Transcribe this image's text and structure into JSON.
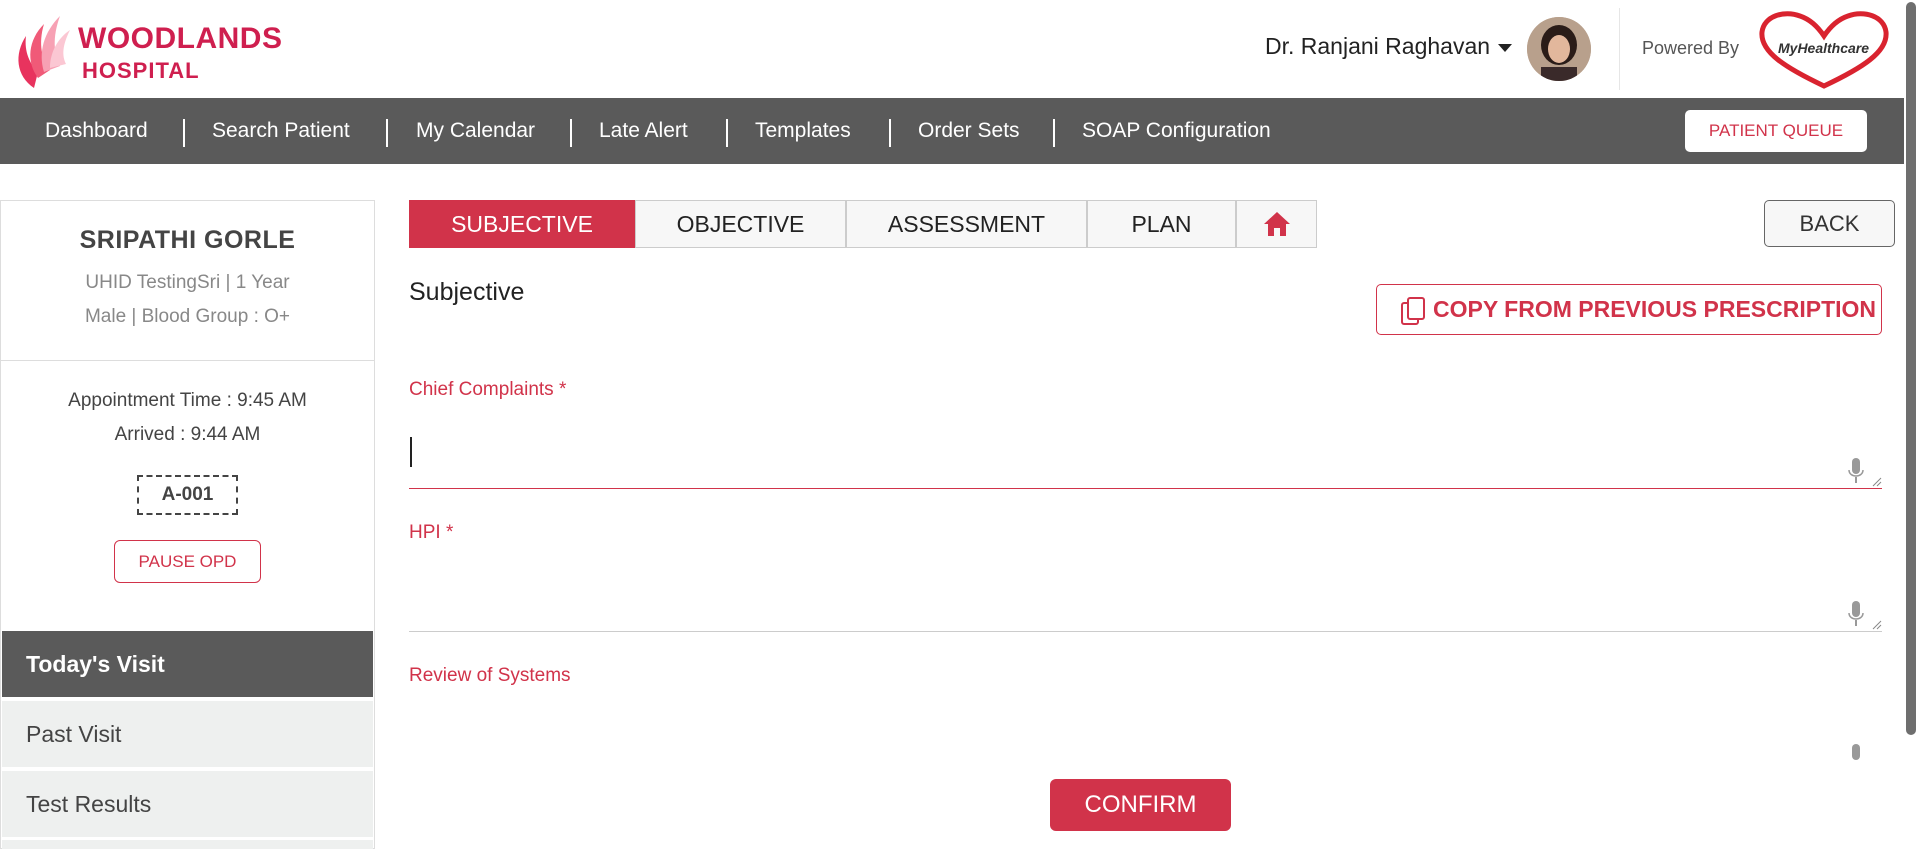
{
  "header": {
    "hospital_name_line1": "WOODLANDS",
    "hospital_name_line2": "HOSPITAL",
    "doctor_name": "Dr. Ranjani Raghavan",
    "powered_by": "Powered By",
    "partner_logo_text": "MyHealthcare"
  },
  "nav": {
    "items": [
      {
        "label": "Dashboard"
      },
      {
        "label": "Search Patient"
      },
      {
        "label": "My Calendar"
      },
      {
        "label": "Late Alert"
      },
      {
        "label": "Templates"
      },
      {
        "label": "Order Sets"
      },
      {
        "label": "SOAP Configuration"
      }
    ],
    "queue_button": "PATIENT QUEUE"
  },
  "patient": {
    "name": "SRIPATHI GORLE",
    "info_line1": "UHID TestingSri | 1 Year",
    "info_line2": "Male | Blood Group : O+",
    "appointment_time": "Appointment Time : 9:45 AM",
    "arrived": "Arrived : 9:44 AM",
    "token": "A-001",
    "pause_button": "PAUSE OPD"
  },
  "sidebar": {
    "items": [
      {
        "label": "Today's Visit",
        "active": true
      },
      {
        "label": "Past Visit",
        "active": false
      },
      {
        "label": "Test Results",
        "active": false
      }
    ]
  },
  "tabs": [
    {
      "label": "SUBJECTIVE",
      "active": true
    },
    {
      "label": "OBJECTIVE",
      "active": false
    },
    {
      "label": "ASSESSMENT",
      "active": false
    },
    {
      "label": "PLAN",
      "active": false
    }
  ],
  "back_button": "BACK",
  "section_title": "Subjective",
  "copy_button": "COPY FROM PREVIOUS PRESCRIPTION",
  "fields": {
    "chief_complaints_label": "Chief Complaints *",
    "chief_complaints_value": "",
    "hpi_label": "HPI *",
    "hpi_value": "",
    "ros_label": "Review of Systems",
    "ros_value": ""
  },
  "confirm_button": "CONFIRM",
  "colors": {
    "brand_red": "#d1334a",
    "nav_gray": "#5a5a5a",
    "logo_pink": "#cf1f4f"
  },
  "icons": {
    "home": "home-icon",
    "copy": "copy-icon",
    "mic": "mic-icon",
    "caret": "caret-down-icon"
  }
}
